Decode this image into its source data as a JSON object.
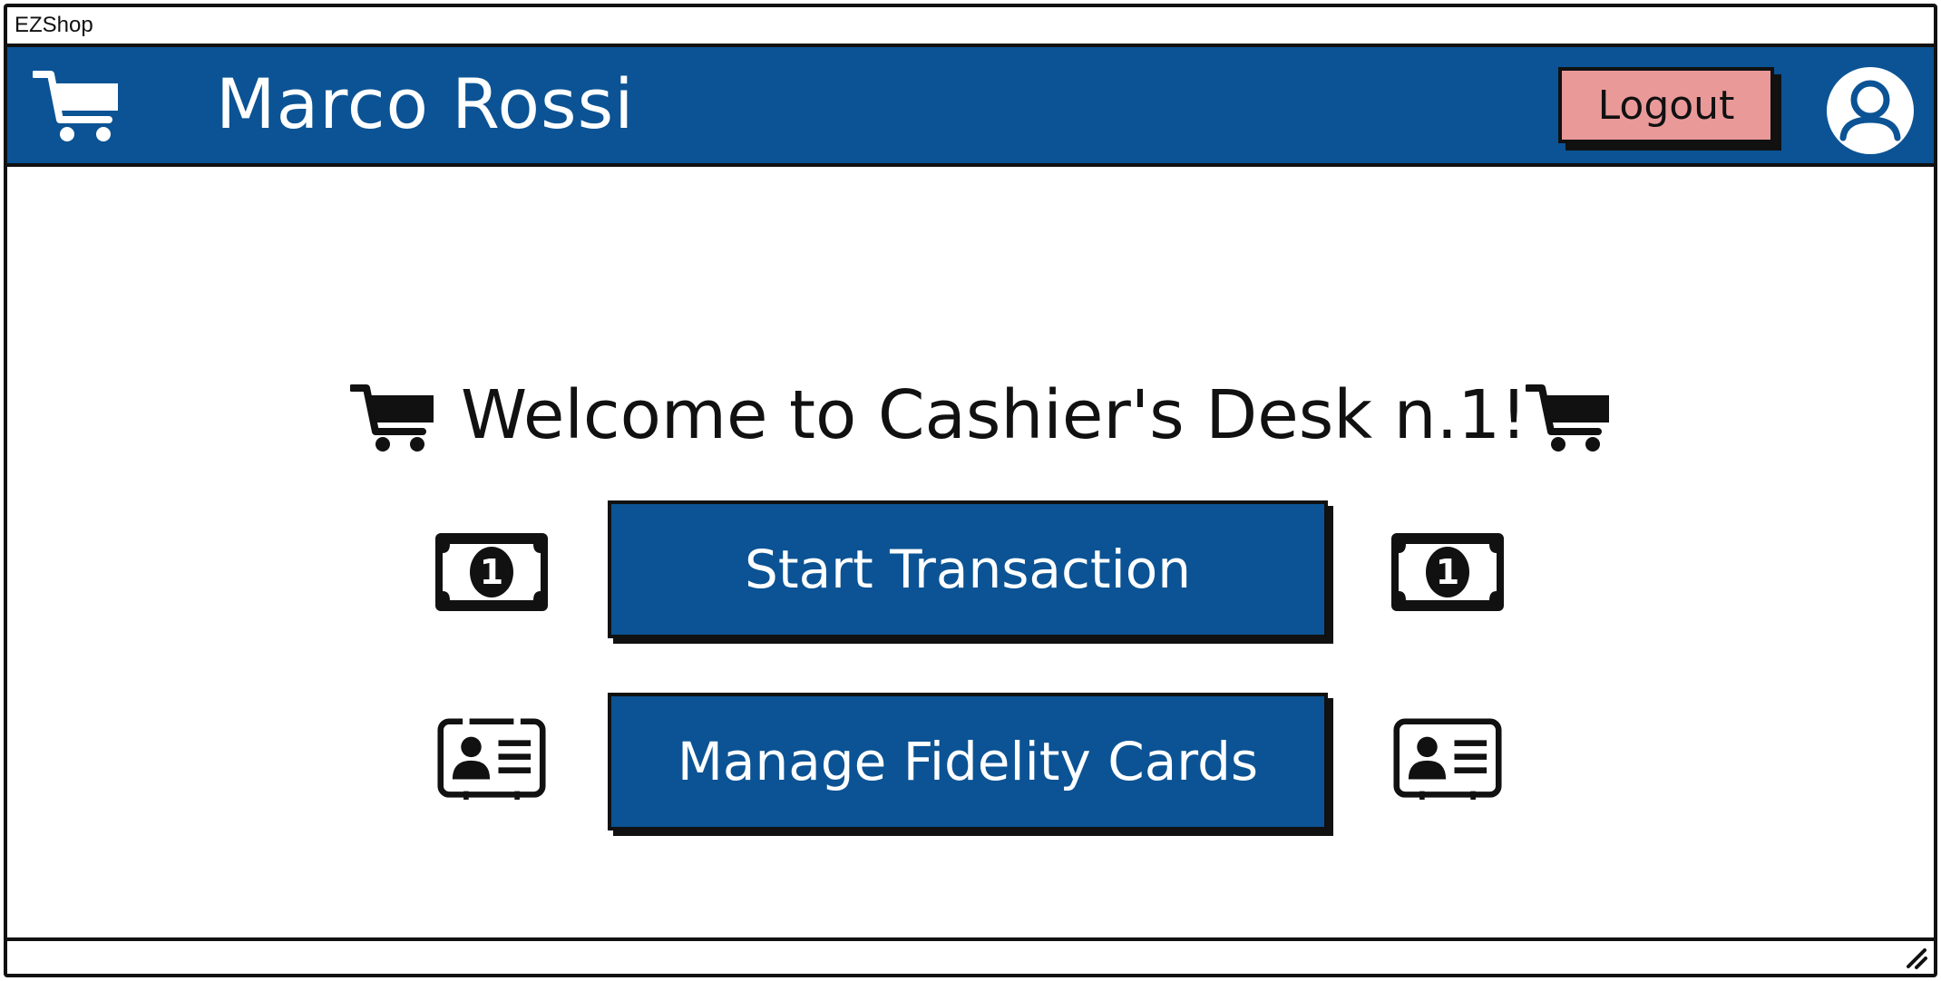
{
  "window": {
    "title": "EZShop"
  },
  "header": {
    "user_name": "Marco Rossi",
    "logout_label": "Logout",
    "cart_icon": "shopping-cart-icon",
    "avatar_icon": "user-avatar-icon"
  },
  "main": {
    "welcome_text": "Welcome to Cashier's Desk n.1!",
    "start_transaction_label": "Start Transaction",
    "manage_fidelity_label": "Manage Fidelity Cards",
    "money_icon": "dollar-bill-icon",
    "card_icon": "id-card-icon"
  },
  "colors": {
    "header_bg": "#0b5394",
    "button_bg": "#0b5394",
    "logout_bg": "#ea9999"
  }
}
